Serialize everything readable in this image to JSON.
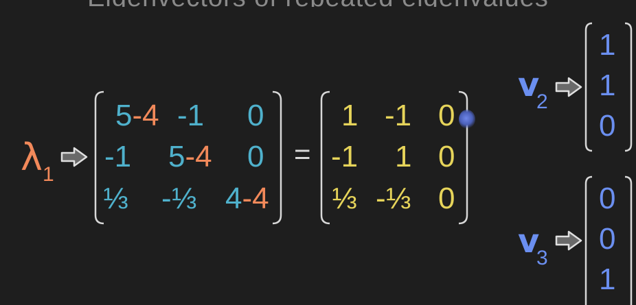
{
  "title": "Eigenvectors of repeated eigenvalues",
  "lambda": {
    "symbol": "λ",
    "subscript": "1"
  },
  "equals": "=",
  "matrix_left": {
    "rows": [
      [
        {
          "a": "5",
          "b": "-4"
        },
        {
          "a": "-1",
          "b": ""
        },
        {
          "a": "0",
          "b": ""
        }
      ],
      [
        {
          "a": "-1",
          "b": ""
        },
        {
          "a": "5",
          "b": "-4"
        },
        {
          "a": "0",
          "b": ""
        }
      ],
      [
        {
          "a": "⅓",
          "b": ""
        },
        {
          "a": "-⅓",
          "b": ""
        },
        {
          "a": "4",
          "b": "-4"
        }
      ]
    ]
  },
  "matrix_right": {
    "rows": [
      [
        "1",
        "-1",
        "0"
      ],
      [
        "-1",
        "1",
        "0"
      ],
      [
        "⅓",
        "-⅓",
        "0"
      ]
    ]
  },
  "v2": {
    "symbol": "v",
    "subscript": "2",
    "values": [
      "1",
      "1",
      "0"
    ]
  },
  "v3": {
    "symbol": "v",
    "subscript": "3",
    "values": [
      "0",
      "0",
      "1"
    ]
  },
  "colors": {
    "background": "#1e1e1e",
    "teal": "#4fb1cc",
    "orange": "#f2895a",
    "yellow": "#e6d45a",
    "blue": "#6b8ff0",
    "bracket": "#d8d8d8"
  },
  "icons": [
    "arrow-right-icon",
    "cursor-icon"
  ]
}
